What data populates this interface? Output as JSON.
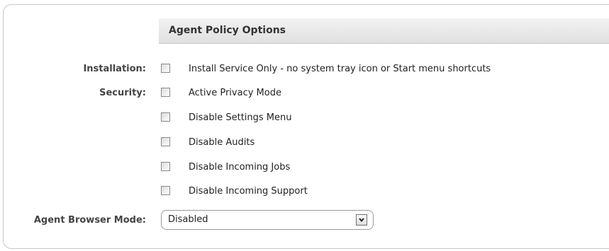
{
  "section": {
    "title": "Agent Policy Options"
  },
  "rows": [
    {
      "label": "Installation:",
      "option": "Install Service Only - no system tray icon or Start menu shortcuts",
      "checked": false
    },
    {
      "label": "Security:",
      "option": "Active Privacy Mode",
      "checked": false
    },
    {
      "label": "",
      "option": "Disable Settings Menu",
      "checked": false
    },
    {
      "label": "",
      "option": "Disable Audits",
      "checked": false
    },
    {
      "label": "",
      "option": "Disable Incoming Jobs",
      "checked": false
    },
    {
      "label": "",
      "option": "Disable Incoming Support",
      "checked": false
    }
  ],
  "browser_mode": {
    "label": "Agent Browser Mode:",
    "selected": "Disabled"
  },
  "colors": {
    "panel_border": "#c8c8c8",
    "header_background": "#e6e6e6",
    "label_text": "#444444",
    "option_text": "#222222"
  },
  "icons": {
    "dropdown": "chevron-down-icon"
  }
}
